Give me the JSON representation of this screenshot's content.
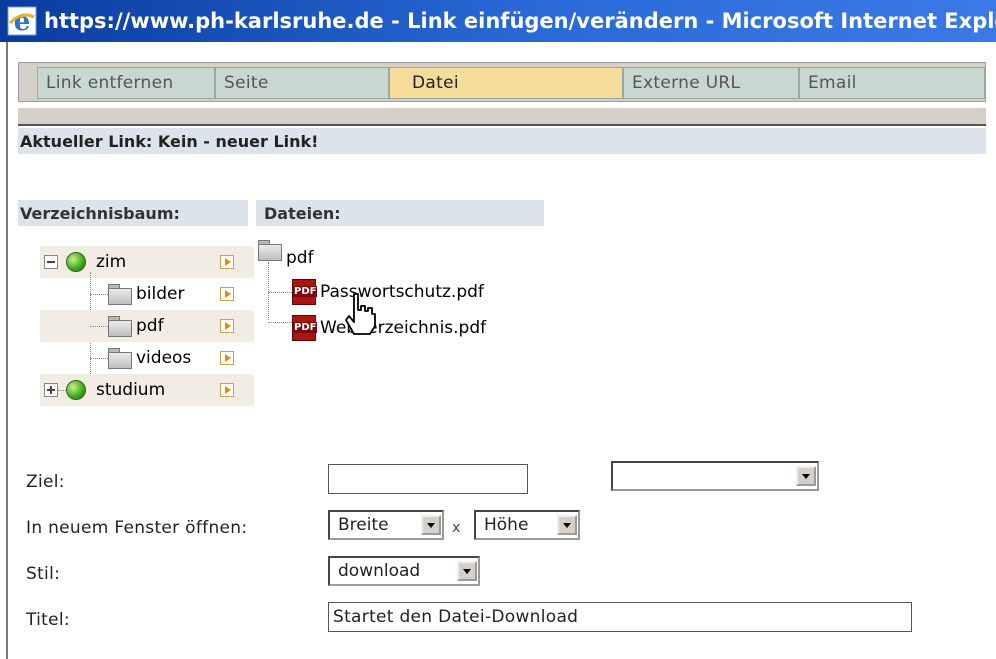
{
  "window": {
    "title": "https://www.ph-karlsruhe.de - Link einfügen/verändern - Microsoft Internet Explorer"
  },
  "tabs": [
    {
      "label": "Link entfernen",
      "active": false
    },
    {
      "label": "Seite",
      "active": false
    },
    {
      "label": "Datei",
      "active": true
    },
    {
      "label": "Externe URL",
      "active": false
    },
    {
      "label": "Email",
      "active": false
    }
  ],
  "current_link": "Aktueller Link: Kein - neuer Link!",
  "tree": {
    "heading": "Verzeichnisbaum:",
    "items": [
      {
        "label": "zim",
        "icon": "globe-icon",
        "expanded": true
      },
      {
        "label": "bilder",
        "icon": "folder-icon"
      },
      {
        "label": "pdf",
        "icon": "folder-icon"
      },
      {
        "label": "videos",
        "icon": "folder-icon"
      },
      {
        "label": "studium",
        "icon": "globe-icon",
        "expanded": false
      }
    ]
  },
  "files": {
    "heading": "Dateien:",
    "folder": "pdf",
    "items": [
      "Passwortschutz.pdf",
      "Webverzeichnis.pdf"
    ]
  },
  "form": {
    "ziel_label": "Ziel:",
    "ziel_value": "",
    "ziel_select_value": "",
    "new_window_label": "In neuem Fenster öffnen:",
    "breite_value": "Breite",
    "times": "x",
    "hoehe_value": "Höhe",
    "stil_label": "Stil:",
    "stil_value": "download",
    "titel_label": "Titel:",
    "titel_value": "Startet den Datei-Download"
  },
  "colors": {
    "active_tab": "#f5dc9a",
    "inactive_tab": "#c8d8d0",
    "title_bar": "#0a3c9e",
    "header_band": "#dde3ea"
  }
}
